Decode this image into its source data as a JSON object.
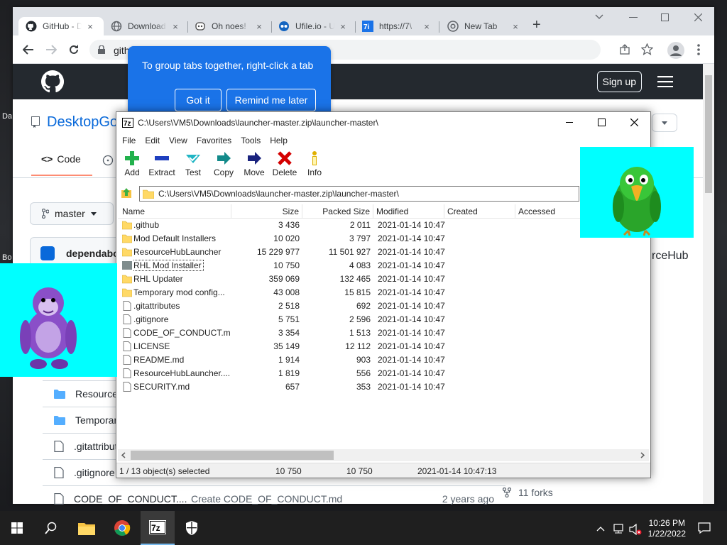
{
  "desktop": {
    "labels": [
      "Da",
      "Bo"
    ]
  },
  "browser": {
    "tabs": [
      {
        "label": "GitHub - D",
        "icon": "github-icon",
        "active": true
      },
      {
        "label": "Download",
        "icon": "globe-icon"
      },
      {
        "label": "Oh noes!",
        "icon": "octocat-icon"
      },
      {
        "label": "Ufile.io - U",
        "icon": "ufile-icon"
      },
      {
        "label": "https://7\\",
        "icon": "7zip-icon"
      },
      {
        "label": "New Tab",
        "icon": "chrome-icon"
      }
    ],
    "address": "githu",
    "tab_close": "×",
    "new_tab": "+"
  },
  "tooltip": {
    "text": "To group tabs together, right-click a tab",
    "got_it": "Got it",
    "remind_later": "Remind me later"
  },
  "github": {
    "sign_up": "Sign up",
    "repo_name": "DesktopGo",
    "code_tab": "Code",
    "branch": "master",
    "commit_author": "dependabo",
    "right_text": "rceHub",
    "rows": [
      {
        "name": "ResourceHub",
        "icon": "folder"
      },
      {
        "name": "Temporary m",
        "icon": "folder"
      },
      {
        "name": ".gitattribute",
        "icon": "file"
      },
      {
        "name": ".gitignore",
        "icon": "file"
      },
      {
        "name": "CODE_OF_CONDUCT....",
        "icon": "file",
        "commit": "Create CODE_OF_CONDUCT.md",
        "age": "2 years ago"
      }
    ],
    "forks": "11 forks"
  },
  "zip": {
    "title": "C:\\Users\\VM5\\Downloads\\launcher-master.zip\\launcher-master\\",
    "menu": [
      "File",
      "Edit",
      "View",
      "Favorites",
      "Tools",
      "Help"
    ],
    "tools": [
      "Add",
      "Extract",
      "Test",
      "Copy",
      "Move",
      "Delete",
      "Info"
    ],
    "path": "C:\\Users\\VM5\\Downloads\\launcher-master.zip\\launcher-master\\",
    "columns": [
      "Name",
      "Size",
      "Packed Size",
      "Modified",
      "Created",
      "Accessed"
    ],
    "files": [
      {
        "name": ".github",
        "size": "3 436",
        "packed": "2 011",
        "modified": "2021-01-14 10:47",
        "type": "folder"
      },
      {
        "name": "Mod Default Installers",
        "size": "10 020",
        "packed": "3 797",
        "modified": "2021-01-14 10:47",
        "type": "folder"
      },
      {
        "name": "ResourceHubLauncher",
        "size": "15 229 977",
        "packed": "11 501 927",
        "modified": "2021-01-14 10:47",
        "type": "folder"
      },
      {
        "name": "RHL Mod Installer",
        "size": "10 750",
        "packed": "4 083",
        "modified": "2021-01-14 10:47",
        "type": "folder",
        "selected": true
      },
      {
        "name": "RHL Updater",
        "size": "359 069",
        "packed": "132 465",
        "modified": "2021-01-14 10:47",
        "type": "folder"
      },
      {
        "name": "Temporary mod config...",
        "size": "43 008",
        "packed": "15 815",
        "modified": "2021-01-14 10:47",
        "type": "folder"
      },
      {
        "name": ".gitattributes",
        "size": "2 518",
        "packed": "692",
        "modified": "2021-01-14 10:47",
        "type": "file"
      },
      {
        "name": ".gitignore",
        "size": "5 751",
        "packed": "2 596",
        "modified": "2021-01-14 10:47",
        "type": "file"
      },
      {
        "name": "CODE_OF_CONDUCT.md",
        "size": "3 354",
        "packed": "1 513",
        "modified": "2021-01-14 10:47",
        "type": "file"
      },
      {
        "name": "LICENSE",
        "size": "35 149",
        "packed": "12 112",
        "modified": "2021-01-14 10:47",
        "type": "file"
      },
      {
        "name": "README.md",
        "size": "1 914",
        "packed": "903",
        "modified": "2021-01-14 10:47",
        "type": "file"
      },
      {
        "name": "ResourceHubLauncher....",
        "size": "1 819",
        "packed": "556",
        "modified": "2021-01-14 10:47",
        "type": "file"
      },
      {
        "name": "SECURITY.md",
        "size": "657",
        "packed": "353",
        "modified": "2021-01-14 10:47",
        "type": "file"
      }
    ],
    "status": {
      "selected": "1 / 13 object(s) selected",
      "size": "10 750",
      "packed": "10 750",
      "modified": "2021-01-14 10:47:13"
    }
  },
  "taskbar": {
    "time": "10:26 PM",
    "date": "1/22/2022"
  }
}
